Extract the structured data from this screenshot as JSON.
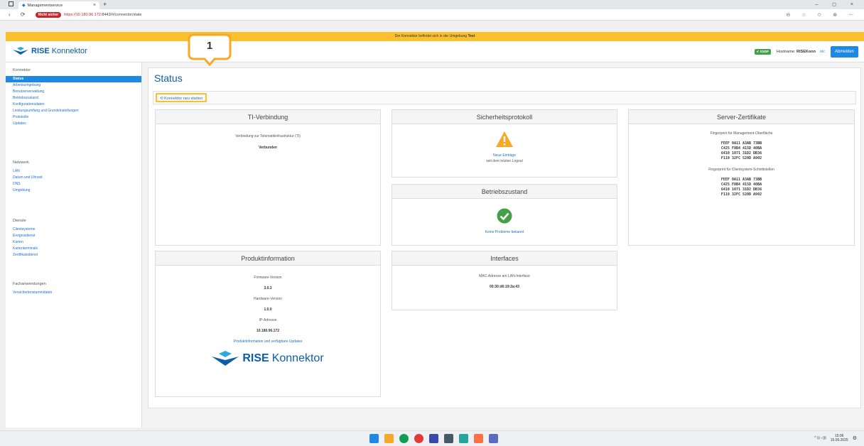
{
  "browser": {
    "tab_title": "Managementservice",
    "tab_close": "×",
    "new_tab": "+",
    "nav_icons": "‹ ⟳",
    "unsafe_label": "Nicht sicher",
    "url_host": "https://10.180.96.172",
    "url_path": ":8443/#/connector/state",
    "window_controls": "– ◻ ×",
    "toolbar_icons": "⊖ ☆ ✩ ⊕ ⋯"
  },
  "env_banner": {
    "prefix": "Der Konnektor befindet sich in der Umgebung",
    "env": "Test"
  },
  "header": {
    "brand_bold": "RISE",
    "brand_rest": "Konnektor",
    "status_badge": "✔ SSDP",
    "hostname_label": "Hostname:",
    "hostname_value": "RISEKonn",
    "olc": "olc",
    "logout": "Abmelden"
  },
  "sidebar": {
    "sections": [
      {
        "title": "Konnektor",
        "items": [
          "Status",
          "Arbeitsumgebung",
          "Benutzerverwaltung",
          "Betriebszustand",
          "Konfigurationsdaten",
          "Leistungsumfang und Grundeinstellungen",
          "Protokolle",
          "Updates"
        ]
      },
      {
        "title": "Netzwerk",
        "items": [
          "LAN",
          "Datum und Uhrzeit",
          "DNS",
          "Umgebung"
        ]
      },
      {
        "title": "Dienste",
        "items": [
          "Clientsysteme",
          "Ereignisdienst",
          "Karten",
          "Kartenterminals",
          "Zertifikatsdienst"
        ]
      },
      {
        "title": "Fachanwendungen",
        "items": [
          "Versichertenstammdaten"
        ]
      }
    ]
  },
  "page": {
    "title": "Status",
    "restart_button": "⟲ Konnektor neu starten",
    "callout_number": "1"
  },
  "cards": {
    "ti": {
      "title": "TI-Verbindung",
      "desc": "Verbindung zur Telematikinfrastruktur (TI)",
      "status": "Verbunden"
    },
    "security": {
      "title": "Sicherheitsprotokoll",
      "link": "Neue Einträge",
      "sub": "seit dem letzten Logout"
    },
    "operation": {
      "title": "Betriebszustand",
      "link": "Keine Probleme bekannt"
    },
    "certs": {
      "title": "Server-Zertifikate",
      "mgmt_label": "Fingerprint für Management-Oberfläche",
      "mgmt_fp": [
        "FEEF 0A11 A3AB 73BB",
        "C425 F8B4 415D 40BA",
        "6410 1071 31D2 DB36",
        "F119 32FC 520D A902"
      ],
      "client_label": "Fingerprint für Clientsystem-Schnittstellen",
      "client_fp": [
        "FEEF 0A11 A3AB 73BB",
        "C425 F8B4 415D 40BA",
        "6410 1071 31D2 DB36",
        "F119 32FC 520D A902"
      ]
    },
    "product": {
      "title": "Produktinformation",
      "fw_label": "Firmware-Version",
      "fw_value": "3.0.3",
      "hw_label": "Hardware-Version",
      "hw_value": "1.0.0",
      "ip_label": "IP-Adresse",
      "ip_value": "10.180.96.172",
      "link": "Produktinformation und verfügbare Updates",
      "logo_bold": "RISE",
      "logo_rest": "Konnektor"
    },
    "interfaces": {
      "title": "Interfaces",
      "mac_label": "MAC-Adresse am LAN-Interface",
      "mac_value": "00:30:d6:19:2a:43"
    }
  },
  "taskbar": {
    "time": "15:06",
    "date": "15.09.2025",
    "tray_icons": "^ ⊡ ◁))"
  },
  "colors": {
    "accent": "#1e88e5",
    "brand": "#0d5ea8",
    "env_banner": "#fbc02d",
    "callout": "#f9a825",
    "ok": "#43a047",
    "warning": "#f9a825"
  }
}
